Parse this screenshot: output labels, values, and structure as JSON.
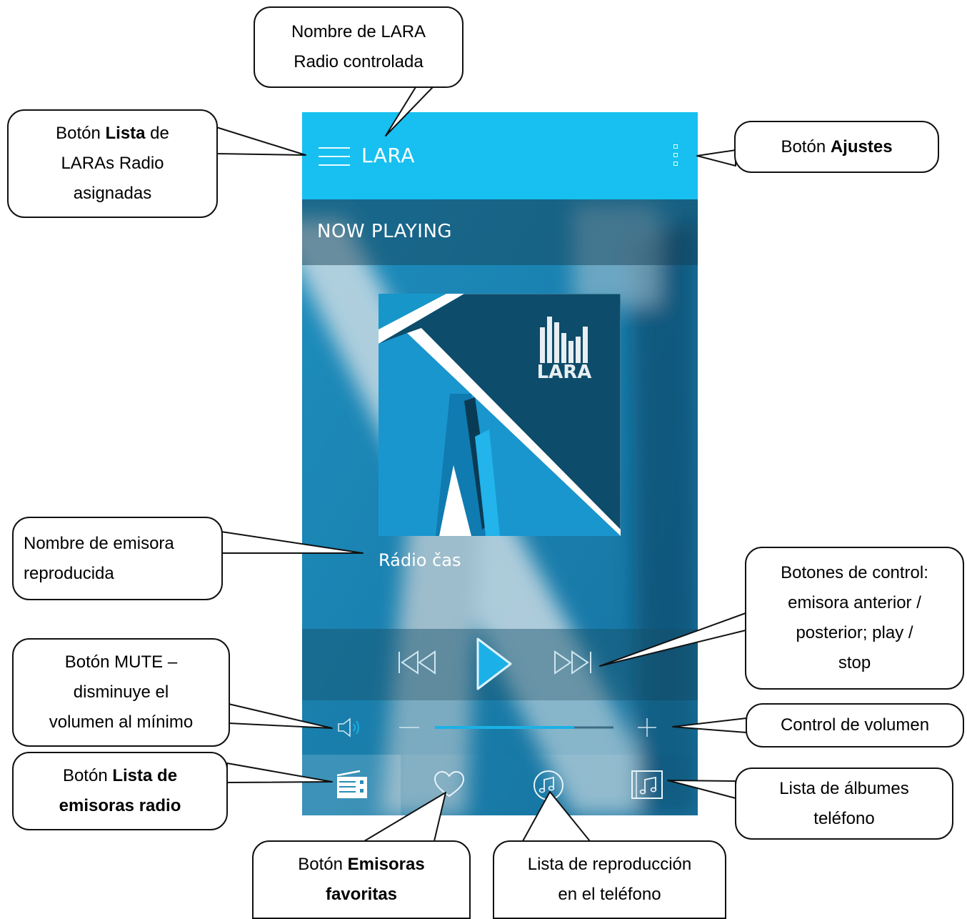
{
  "app": {
    "title": "LARA",
    "section_header": "NOW PLAYING",
    "station_name": "Rádio čas",
    "cover_logo_text": "LARA",
    "volume_level": 0.78
  },
  "icons": {
    "menu": "hamburger-icon",
    "settings": "more-vertical-icon",
    "previous": "skip-previous-icon",
    "play": "play-icon",
    "next": "skip-next-icon",
    "mute": "speaker-icon",
    "volume_down": "minus-icon",
    "volume_up": "plus-icon",
    "radio_list": "radio-icon",
    "favorites": "heart-icon",
    "playlist": "music-note-circle-icon",
    "albums": "album-icon"
  },
  "colors": {
    "topbar": "#17c0f0",
    "accent": "#1bb1e6",
    "background": "#1a9ac7"
  },
  "callouts": {
    "radio_name": {
      "line1": "Nombre de LARA",
      "line2": "Radio controlada"
    },
    "list_button": {
      "pre": "Botón ",
      "bold": "Lista",
      "post": " de",
      "line2": "LARAs Radio",
      "line3": "asignadas"
    },
    "settings_button": {
      "pre": "Botón ",
      "bold": "Ajustes"
    },
    "station_name": {
      "line1": "Nombre de emisora",
      "line2": "reproducida"
    },
    "controls": {
      "line1": "Botones de control:",
      "line2": "emisora anterior /",
      "line3": "posterior;  play /",
      "line4": "stop"
    },
    "mute": {
      "line1": "Botón MUTE –",
      "line2": "disminuye el",
      "line3": "volumen al mínimo"
    },
    "volume": {
      "text": "Control de volumen"
    },
    "radio_list": {
      "pre": "Botón ",
      "bold1": "Lista de",
      "bold2": "emisoras radio"
    },
    "favorites": {
      "pre": "Botón ",
      "bold1": "Emisoras",
      "bold2": "favoritas"
    },
    "playlist": {
      "line1": "Lista de reproducción",
      "line2": "en el teléfono"
    },
    "albums": {
      "line1": "Lista de álbumes",
      "line2": "teléfono"
    }
  }
}
